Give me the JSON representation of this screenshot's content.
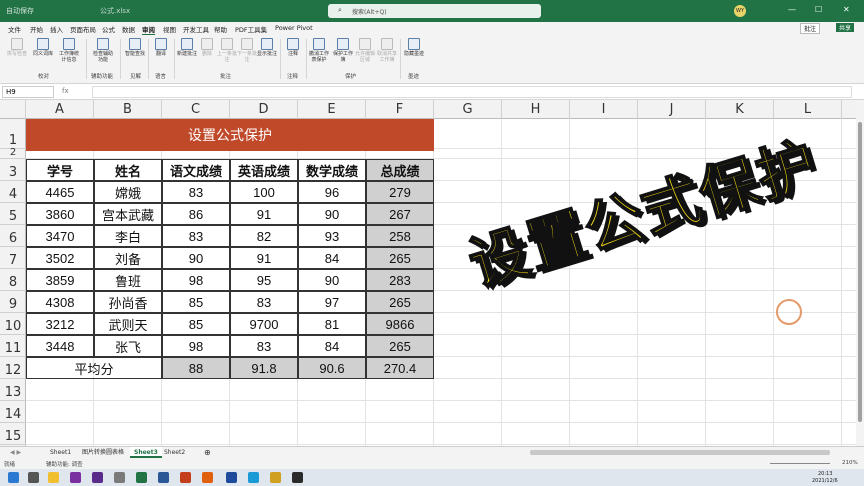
{
  "titlebar": {
    "autosave": "自动保存",
    "filename": "公式.xlsx",
    "search_placeholder": "搜索(Alt+Q)",
    "avatar": "WY",
    "win_min": "—",
    "win_max": "☐",
    "win_close": "✕"
  },
  "menu": {
    "items": [
      "文件",
      "开始",
      "插入",
      "页面布局",
      "公式",
      "数据",
      "审阅",
      "视图",
      "开发工具",
      "帮助",
      "PDF工具集",
      "Power Pivot"
    ],
    "active": "审阅",
    "comment": "批注",
    "share": "共享"
  },
  "ribbon": {
    "buttons": [
      {
        "label": "拼写检查",
        "disabled": true
      },
      {
        "label": "同义词库",
        "disabled": false
      },
      {
        "label": "工作簿统计信息",
        "disabled": false
      },
      {
        "label": "检查辅助功能",
        "disabled": false
      },
      {
        "label": "智能查找",
        "disabled": false
      },
      {
        "label": "翻译",
        "disabled": false
      },
      {
        "label": "新建批注",
        "disabled": false
      },
      {
        "label": "删除",
        "disabled": true
      },
      {
        "label": "上一条批注",
        "disabled": true
      },
      {
        "label": "下一条批注",
        "disabled": true
      },
      {
        "label": "显示批注",
        "disabled": false
      },
      {
        "label": "注释",
        "disabled": false
      },
      {
        "label": "撤消工作表保护",
        "disabled": false
      },
      {
        "label": "保护工作簿",
        "disabled": false
      },
      {
        "label": "允许编辑区域",
        "disabled": true
      },
      {
        "label": "取消共享工作簿",
        "disabled": true
      },
      {
        "label": "隐藏墨迹",
        "disabled": false
      }
    ],
    "groups": [
      "校对",
      "辅助功能",
      "见解",
      "语言",
      "批注",
      "注释",
      "保护",
      "墨迹"
    ]
  },
  "formula_bar": {
    "name_box": "H9",
    "fx": "fx",
    "formula": ""
  },
  "columns": [
    "A",
    "B",
    "C",
    "D",
    "E",
    "F",
    "G",
    "H",
    "I",
    "J",
    "K",
    "L"
  ],
  "rows": [
    "1",
    "2",
    "3",
    "4",
    "5",
    "6",
    "7",
    "8",
    "9",
    "10",
    "11",
    "12",
    "13",
    "14",
    "15"
  ],
  "table": {
    "title": "设置公式保护",
    "headers": [
      "学号",
      "姓名",
      "语文成绩",
      "英语成绩",
      "数学成绩",
      "总成绩"
    ],
    "rows": [
      [
        "4465",
        "嫦娥",
        "83",
        "100",
        "96",
        "279"
      ],
      [
        "3860",
        "宫本武藏",
        "86",
        "91",
        "90",
        "267"
      ],
      [
        "3470",
        "李白",
        "83",
        "82",
        "93",
        "258"
      ],
      [
        "3502",
        "刘备",
        "90",
        "91",
        "84",
        "265"
      ],
      [
        "3859",
        "鲁班",
        "98",
        "95",
        "90",
        "283"
      ],
      [
        "4308",
        "孙尚香",
        "85",
        "83",
        "97",
        "265"
      ],
      [
        "3212",
        "武则天",
        "85",
        "9700",
        "81",
        "9866"
      ],
      [
        "3448",
        "张飞",
        "98",
        "83",
        "84",
        "265"
      ]
    ],
    "avg_label": "平均分",
    "avg_values": [
      "88",
      "91.8",
      "90.6",
      "270.4"
    ],
    "colors": {
      "title_bg": "#c0492a",
      "title_text": "#ffffff",
      "gray": "#d0d0d0"
    }
  },
  "overlay_text": "设置公式保护",
  "sheets": {
    "tabs": [
      "Sheet1",
      "图片转换圆表格",
      "Sheet3",
      "Sheet2"
    ],
    "active": "Sheet3",
    "add": "⊕"
  },
  "status": {
    "ready": "就绪",
    "accessibility": "辅助功能: 调查",
    "zoom": "210%"
  },
  "taskbar": {
    "time": "20:13",
    "date": "2021/12/6"
  }
}
